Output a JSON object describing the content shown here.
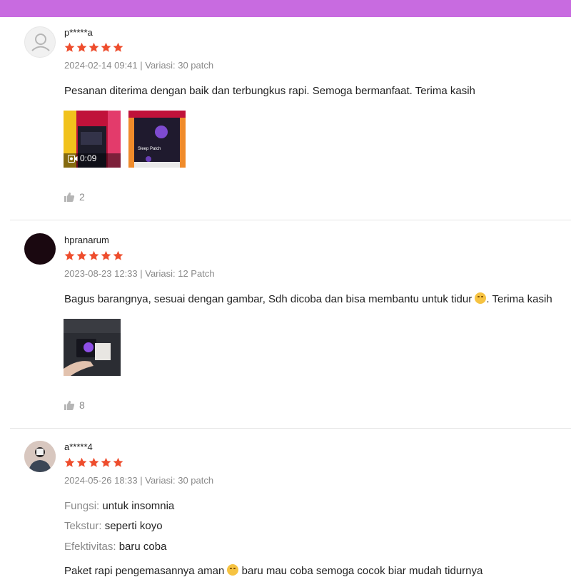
{
  "colors": {
    "topbar": "#c86be0",
    "star": "#ee4d2d",
    "muted": "#8a8a8a"
  },
  "reviews": [
    {
      "username": "p*****a",
      "rating": 5,
      "meta": "2024-02-14 09:41 | Variasi: 30 patch",
      "text": "Pesanan diterima dengan baik dan terbungkus rapi. Semoga bermanfaat. Terima kasih",
      "media": [
        {
          "type": "video",
          "duration": "0:09",
          "icon": "video-camera-icon"
        },
        {
          "type": "image",
          "label": "Sleep Patch"
        }
      ],
      "likes": "2"
    },
    {
      "username": "hpranarum",
      "rating": 5,
      "meta": "2023-08-23 12:33 | Variasi: 12 Patch",
      "text": "Bagus barangnya, sesuai dengan gambar, Sdh dicoba dan bisa membantu untuk tidur",
      "text_after_emoji": ". Terima kasih",
      "media": [
        {
          "type": "image"
        }
      ],
      "likes": "8"
    },
    {
      "username": "a*****4",
      "rating": 5,
      "meta": "2024-05-26 18:33 | Variasi: 30 patch",
      "attributes": [
        {
          "key": "Fungsi:",
          "value": "untuk insomnia"
        },
        {
          "key": "Tekstur:",
          "value": "seperti koyo"
        },
        {
          "key": "Efektivitas:",
          "value": "baru coba"
        }
      ],
      "text_start": "Paket rapi pengemasannya aman",
      "text_end": "baru mau coba semoga cocok biar mudah tidurnya"
    }
  ]
}
